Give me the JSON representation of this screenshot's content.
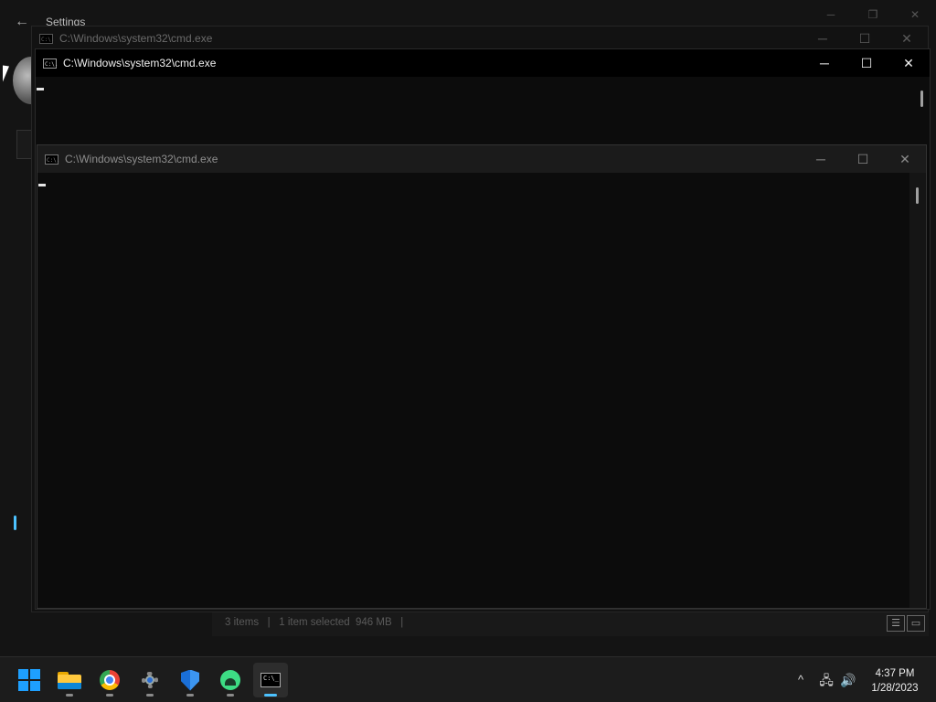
{
  "settings": {
    "title": "Settings",
    "back_glyph": "←",
    "controls": {
      "minimize": "─",
      "restore": "❐",
      "close": "✕"
    },
    "accent_color": "#4cc2ff"
  },
  "explorer_status": {
    "items": "3 items",
    "selected": "1 item selected",
    "size": "946 MB",
    "separator": "|"
  },
  "cmd_windows": [
    {
      "title": "C:\\Windows\\system32\\cmd.exe",
      "state": "inactive",
      "icon_text": "C:\\."
    },
    {
      "title": "C:\\Windows\\system32\\cmd.exe",
      "state": "active",
      "icon_text": "C:\\."
    },
    {
      "title": "C:\\Windows\\system32\\cmd.exe",
      "state": "inactive",
      "icon_text": "C:\\."
    }
  ],
  "window_controls": {
    "minimize": "─",
    "maximize": "☐",
    "close": "✕"
  },
  "taskbar": {
    "apps": [
      {
        "name": "Start",
        "icon": "windows-logo-icon"
      },
      {
        "name": "File Explorer",
        "icon": "folder-icon"
      },
      {
        "name": "Google Chrome",
        "icon": "chrome-icon"
      },
      {
        "name": "Settings",
        "icon": "gear-icon"
      },
      {
        "name": "Windows Security",
        "icon": "shield-icon"
      },
      {
        "name": "Android Studio",
        "icon": "android-studio-icon"
      },
      {
        "name": "Command Prompt",
        "icon": "terminal-icon",
        "active": true
      }
    ],
    "terminal_icon_text": "C:\\_",
    "tray": {
      "chevron": "^",
      "network_glyph": "🖧",
      "volume_glyph": "🔊"
    },
    "clock": {
      "time": "4:37 PM",
      "date": "1/28/2023"
    }
  }
}
